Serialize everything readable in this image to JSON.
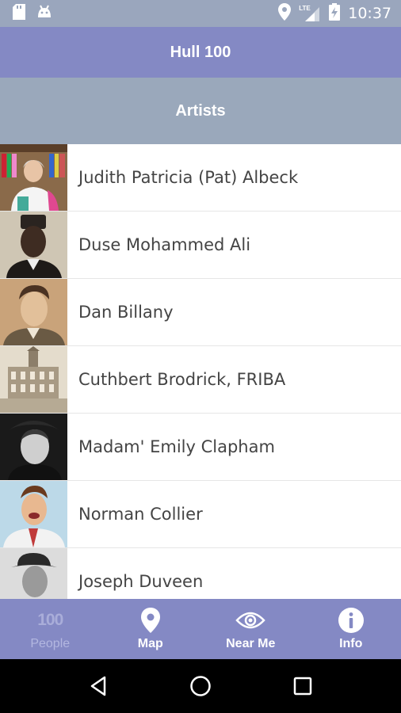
{
  "status_bar": {
    "network_label": "LTE",
    "time": "10:37"
  },
  "app_bar": {
    "title": "Hull 100"
  },
  "section": {
    "title": "Artists"
  },
  "people": [
    {
      "name": "Judith Patricia (Pat) Albeck",
      "photo": "colour-portrait"
    },
    {
      "name": "Duse Mohammed Ali",
      "photo": "sepia-portrait"
    },
    {
      "name": "Dan Billany",
      "photo": "sepia-portrait"
    },
    {
      "name": "Cuthbert Brodrick, FRIBA",
      "photo": "building-engraving"
    },
    {
      "name": "Madam' Emily Clapham",
      "photo": "bw-portrait"
    },
    {
      "name": "Norman Collier",
      "photo": "colour-portrait"
    },
    {
      "name": "Joseph Duveen",
      "photo": "bw-portrait"
    }
  ],
  "bottom_nav": {
    "people": {
      "icon_text": "100",
      "label": "People"
    },
    "map": {
      "label": "Map",
      "icon": "map-pin-icon"
    },
    "near_me": {
      "label": "Near Me",
      "icon": "eye-icon"
    },
    "info": {
      "label": "Info",
      "icon": "info-icon"
    }
  },
  "colors": {
    "status_bar": "#9aa6bd",
    "app_bar": "#8489c4",
    "section_header": "#9aa8bb",
    "bottom_nav": "#8489c4"
  }
}
